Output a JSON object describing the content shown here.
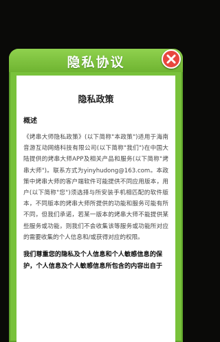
{
  "dialog": {
    "title": "隐私协议",
    "close_icon": "close-icon"
  },
  "document": {
    "heading": "隐私政策",
    "section_title": "概述",
    "paragraph_1": "《烤串大师隐私政策》(以下简称\"本政策\")适用于海南音游互动网络科技有限公司(以下简称\"我们\")在中国大陆提供的烤串大师APP及相关产品和服务(以下简称\"烤串大师\")。联系方式为yinyhudong@163.com。本政策中烤串大师的客户端软件可能提供不同应用版本，用户(以下简称\"您\")须选择与所安装手机相匹配的软件版本，不同版本的烤串大师所提供的功能和服务可能有所不同，但我们承诺，若某一版本的烤串大师不能提供某些服务或功能，则我们不会收集该等服务或功能所对应的需要收集的个人信息和/或获得对应的权限。",
    "paragraph_bold": "我们尊重您的隐私及个人信息和个人敏感信息的保护，个人信息及个人敏感信息所包含的内容出自于"
  },
  "colors": {
    "dialog_green": "#79c23b",
    "close_red": "#e8473f",
    "panel_white": "#ffffff"
  }
}
